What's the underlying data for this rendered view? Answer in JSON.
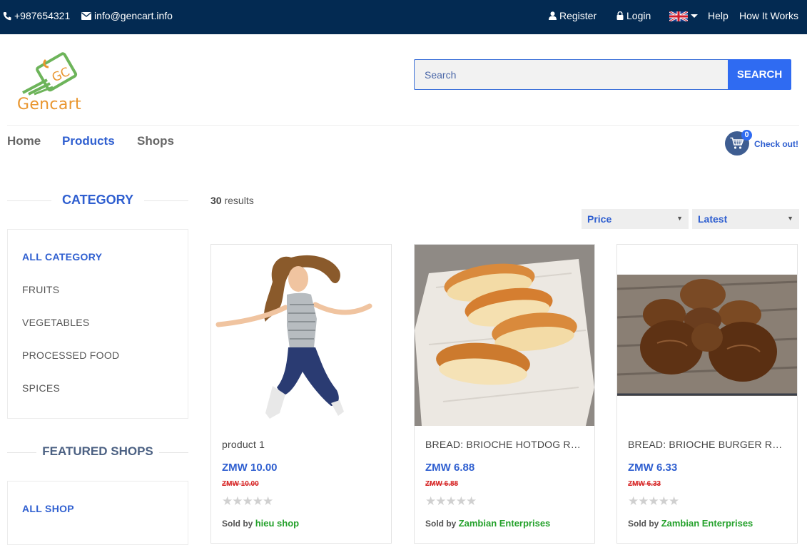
{
  "topbar": {
    "phone": "+987654321",
    "email": "info@gencart.info",
    "register": "Register",
    "login": "Login",
    "help": "Help",
    "how_it_works": "How It Works"
  },
  "logo": {
    "text": "Gencart"
  },
  "search": {
    "placeholder": "Search",
    "button": "SEARCH"
  },
  "nav": {
    "home": "Home",
    "products": "Products",
    "shops": "Shops"
  },
  "cart": {
    "count": "0",
    "checkout": "Check out!"
  },
  "sidebar": {
    "category_title": "CATEGORY",
    "categories": [
      "ALL CATEGORY",
      "FRUITS",
      "VEGETABLES",
      "PROCESSED FOOD",
      "SPICES"
    ],
    "featured_title": "FEATURED SHOPS",
    "shops": [
      "ALL SHOP"
    ]
  },
  "results": {
    "count": "30",
    "label": "results"
  },
  "sort": {
    "price": "Price",
    "latest": "Latest"
  },
  "products": [
    {
      "name": "product 1",
      "price": "ZMW 10.00",
      "old_price": "ZMW 10.00",
      "sold_by": "Sold by",
      "shop": "hieu shop"
    },
    {
      "name": "BREAD: BRIOCHE HOTDOG ROLLS",
      "price": "ZMW 6.88",
      "old_price": "ZMW 6.88",
      "sold_by": "Sold by",
      "shop": "Zambian Enterprises"
    },
    {
      "name": "BREAD: BRIOCHE BURGER ROLLS",
      "price": "ZMW 6.33",
      "old_price": "ZMW 6.33",
      "sold_by": "Sold by",
      "shop": "Zambian Enterprises"
    }
  ],
  "colors": {
    "topbar_bg": "#032a52",
    "accent": "#2f5fd0",
    "button": "#2f6bf2",
    "shop_green": "#24a12b",
    "old_price_red": "#d62424"
  },
  "icons": [
    "phone-icon",
    "envelope-icon",
    "user-icon",
    "lock-icon",
    "uk-flag-icon",
    "cart-icon",
    "star-icon"
  ]
}
